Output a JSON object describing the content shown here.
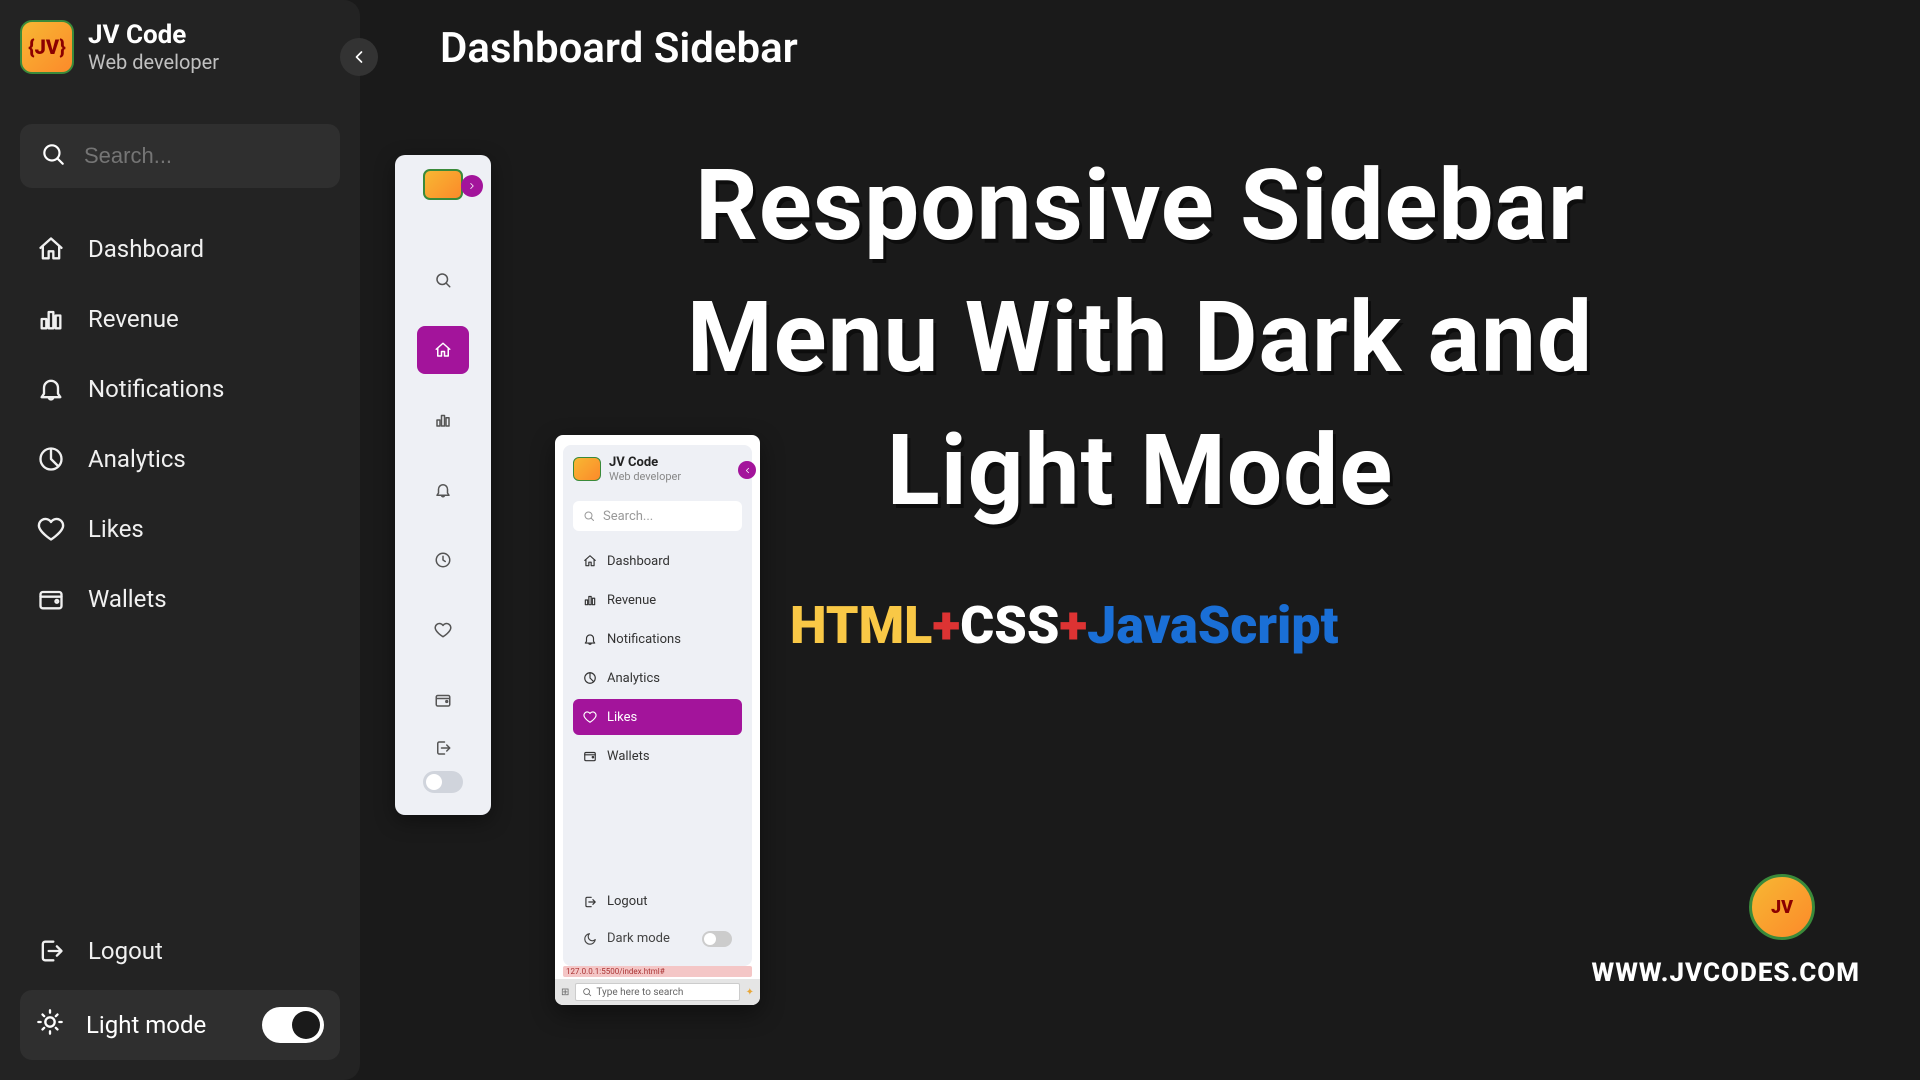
{
  "brand": {
    "name": "JV Code",
    "role": "Web developer"
  },
  "page_title": "Dashboard Sidebar",
  "search": {
    "placeholder": "Search..."
  },
  "nav": [
    {
      "label": "Dashboard",
      "icon": "home"
    },
    {
      "label": "Revenue",
      "icon": "bar-chart"
    },
    {
      "label": "Notifications",
      "icon": "bell"
    },
    {
      "label": "Analytics",
      "icon": "pie"
    },
    {
      "label": "Likes",
      "icon": "heart"
    },
    {
      "label": "Wallets",
      "icon": "wallet"
    }
  ],
  "logout_label": "Logout",
  "theme": {
    "label": "Light mode",
    "icon": "sun"
  },
  "hero": {
    "title": "Responsive Sidebar Menu With Dark and Light Mode",
    "tech": {
      "html": "HTML",
      "css": "CSS",
      "js": "JavaScript",
      "plus": "+"
    }
  },
  "preview_light": {
    "brand": "JV Code",
    "role": "Web developer",
    "search_placeholder": "Search...",
    "nav": [
      "Dashboard",
      "Revenue",
      "Notifications",
      "Analytics",
      "Likes",
      "Wallets"
    ],
    "active_index": 4,
    "logout": "Logout",
    "theme_label": "Dark mode",
    "url": "127.0.0.1:5500/index.html#",
    "taskbar_search": "Type here to search"
  },
  "corner": {
    "url": "WWW.JVCODES.COM",
    "logo_text": "JV"
  },
  "colors": {
    "accent_magenta": "#a3149b",
    "html": "#f9c846",
    "plus": "#d33",
    "js": "#1a6fd6"
  }
}
